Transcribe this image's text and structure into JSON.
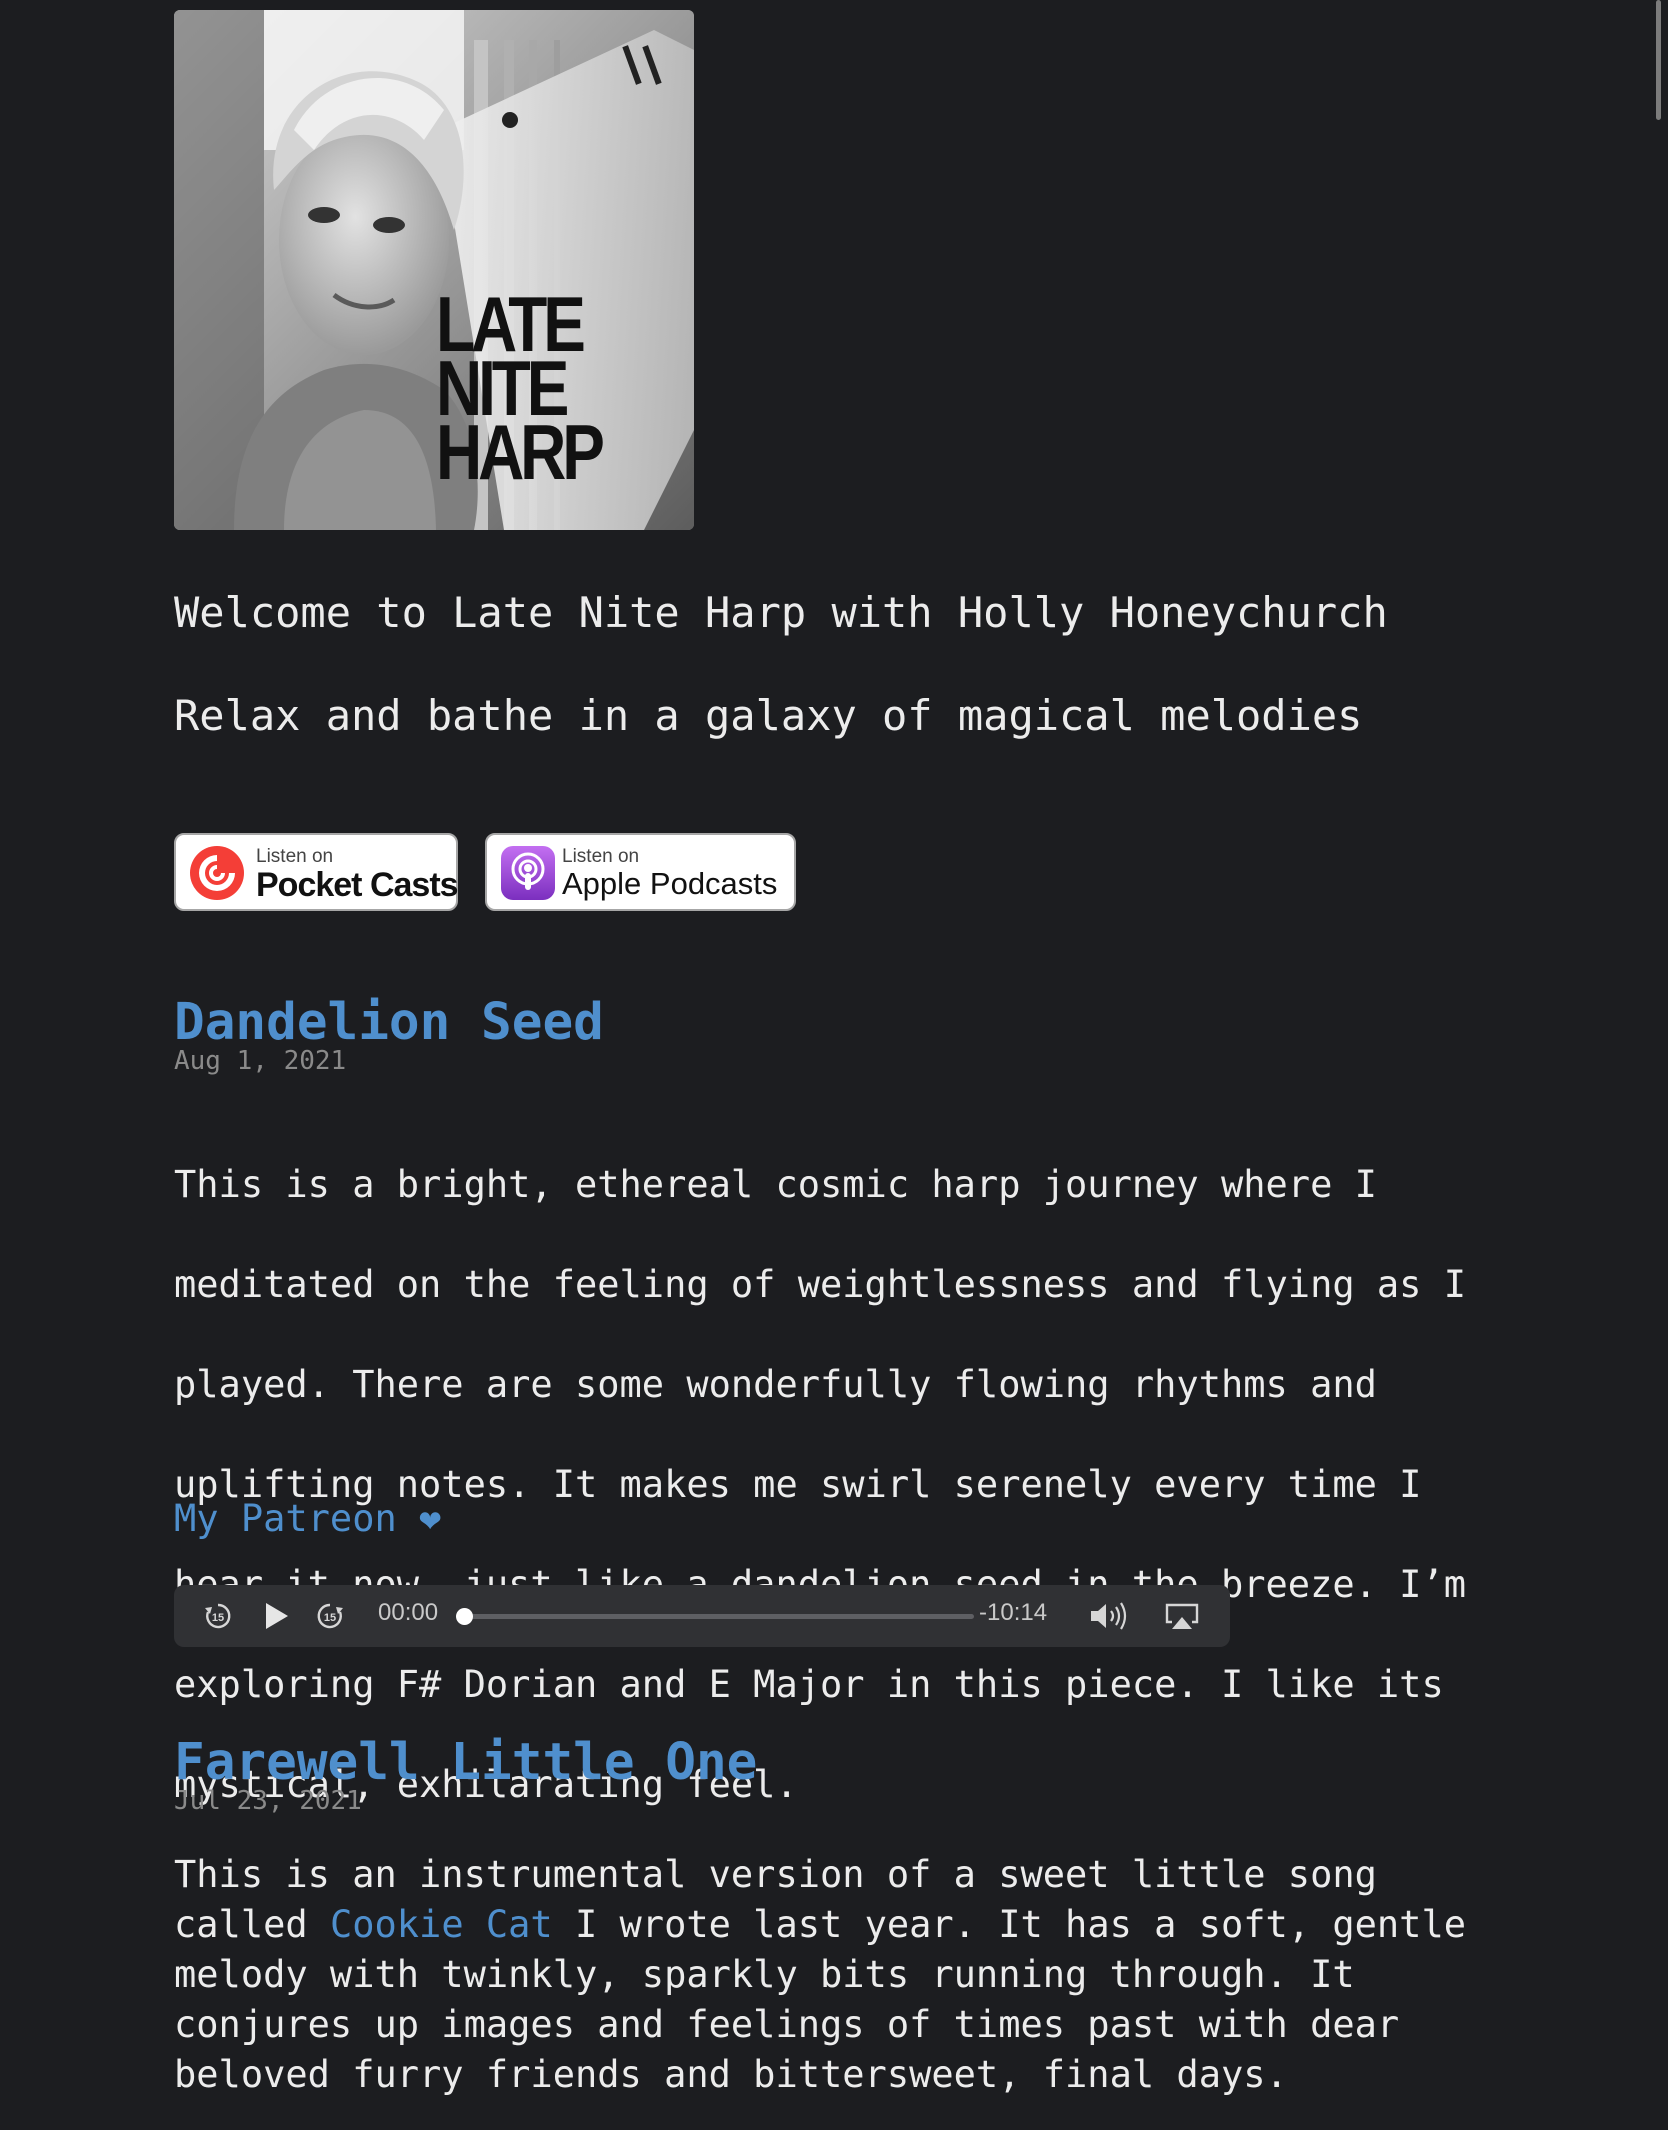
{
  "podcast": {
    "cover_alt": "LATE NITE HARP",
    "cover_lines": [
      "LATE",
      "NITE",
      "HARP"
    ],
    "welcome": "Welcome to Late Nite Harp with Holly Honeychurch",
    "tagline": "Relax and bathe in a galaxy of magical melodies"
  },
  "badges": {
    "pocket": {
      "small": "Listen on",
      "big": "Pocket Casts"
    },
    "apple": {
      "small": "Listen on",
      "big": "Apple Podcasts"
    }
  },
  "episodes": [
    {
      "title": "Dandelion Seed",
      "date": "Aug 1, 2021",
      "description_lines": [
        "This is a bright, ethereal cosmic harp journey where I",
        "meditated on the feeling of weightlessness and flying as I",
        "played. There are some wonderfully flowing rhythms and",
        "uplifting notes. It makes me swirl serenely every time I",
        "hear it now, just like a dandelion seed in the breeze. I’m",
        "exploring F# Dorian and E Major in this piece. I like its",
        "mystical, exhilarating feel."
      ],
      "patreon_label": "My Patreon ❤",
      "player": {
        "elapsed": "00:00",
        "remaining": "-10:14",
        "progress": 0
      }
    },
    {
      "title": "Farewell Little One",
      "date": "Jul 23, 2021",
      "description_before_link": "This is an instrumental version of a sweet little song\ncalled ",
      "description_link": "Cookie Cat",
      "description_after_link": " I wrote last year. It has a soft, gentle\nmelody with twinkly, sparkly bits running through. It\nconjures up images and feelings of times past with dear\nbeloved furry friends and bittersweet, final days."
    }
  ],
  "icons": {
    "rewind": "skip-back-15-icon",
    "play": "play-icon",
    "forward": "skip-forward-15-icon",
    "volume": "volume-icon",
    "airplay": "airplay-icon"
  },
  "colors": {
    "background": "#1c1d20",
    "link": "#4f8fcd",
    "text": "#ececec",
    "muted": "#8a8a8a",
    "player_bg": "#303134"
  }
}
